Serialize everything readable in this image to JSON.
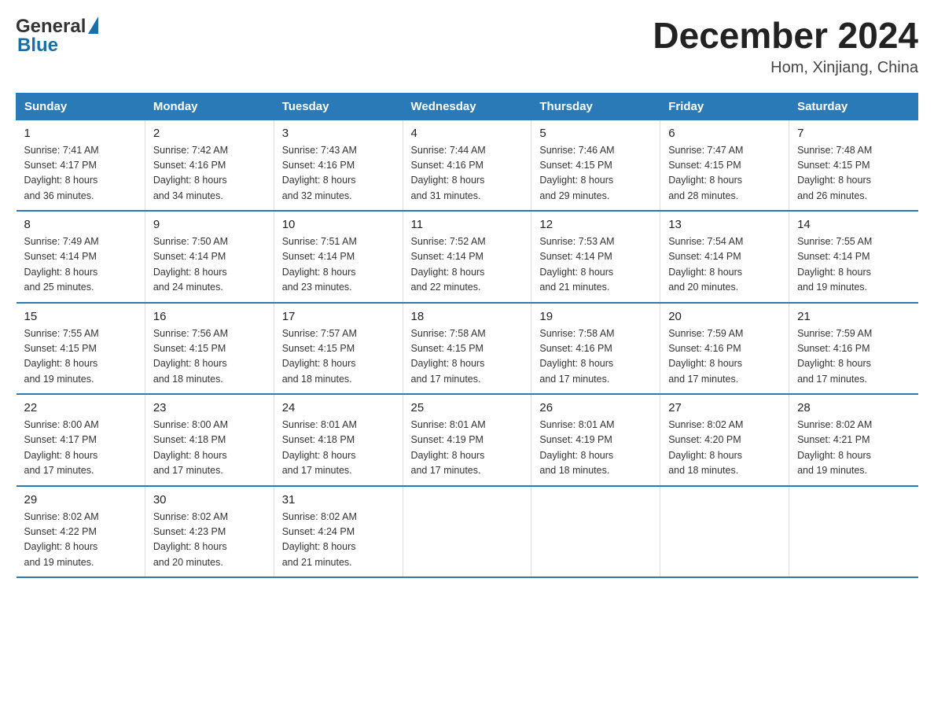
{
  "logo": {
    "text_general": "General",
    "text_blue": "Blue"
  },
  "header": {
    "month_year": "December 2024",
    "location": "Hom, Xinjiang, China"
  },
  "days_of_week": [
    "Sunday",
    "Monday",
    "Tuesday",
    "Wednesday",
    "Thursday",
    "Friday",
    "Saturday"
  ],
  "weeks": [
    [
      {
        "num": "1",
        "sunrise": "7:41 AM",
        "sunset": "4:17 PM",
        "daylight": "8 hours and 36 minutes."
      },
      {
        "num": "2",
        "sunrise": "7:42 AM",
        "sunset": "4:16 PM",
        "daylight": "8 hours and 34 minutes."
      },
      {
        "num": "3",
        "sunrise": "7:43 AM",
        "sunset": "4:16 PM",
        "daylight": "8 hours and 32 minutes."
      },
      {
        "num": "4",
        "sunrise": "7:44 AM",
        "sunset": "4:16 PM",
        "daylight": "8 hours and 31 minutes."
      },
      {
        "num": "5",
        "sunrise": "7:46 AM",
        "sunset": "4:15 PM",
        "daylight": "8 hours and 29 minutes."
      },
      {
        "num": "6",
        "sunrise": "7:47 AM",
        "sunset": "4:15 PM",
        "daylight": "8 hours and 28 minutes."
      },
      {
        "num": "7",
        "sunrise": "7:48 AM",
        "sunset": "4:15 PM",
        "daylight": "8 hours and 26 minutes."
      }
    ],
    [
      {
        "num": "8",
        "sunrise": "7:49 AM",
        "sunset": "4:14 PM",
        "daylight": "8 hours and 25 minutes."
      },
      {
        "num": "9",
        "sunrise": "7:50 AM",
        "sunset": "4:14 PM",
        "daylight": "8 hours and 24 minutes."
      },
      {
        "num": "10",
        "sunrise": "7:51 AM",
        "sunset": "4:14 PM",
        "daylight": "8 hours and 23 minutes."
      },
      {
        "num": "11",
        "sunrise": "7:52 AM",
        "sunset": "4:14 PM",
        "daylight": "8 hours and 22 minutes."
      },
      {
        "num": "12",
        "sunrise": "7:53 AM",
        "sunset": "4:14 PM",
        "daylight": "8 hours and 21 minutes."
      },
      {
        "num": "13",
        "sunrise": "7:54 AM",
        "sunset": "4:14 PM",
        "daylight": "8 hours and 20 minutes."
      },
      {
        "num": "14",
        "sunrise": "7:55 AM",
        "sunset": "4:14 PM",
        "daylight": "8 hours and 19 minutes."
      }
    ],
    [
      {
        "num": "15",
        "sunrise": "7:55 AM",
        "sunset": "4:15 PM",
        "daylight": "8 hours and 19 minutes."
      },
      {
        "num": "16",
        "sunrise": "7:56 AM",
        "sunset": "4:15 PM",
        "daylight": "8 hours and 18 minutes."
      },
      {
        "num": "17",
        "sunrise": "7:57 AM",
        "sunset": "4:15 PM",
        "daylight": "8 hours and 18 minutes."
      },
      {
        "num": "18",
        "sunrise": "7:58 AM",
        "sunset": "4:15 PM",
        "daylight": "8 hours and 17 minutes."
      },
      {
        "num": "19",
        "sunrise": "7:58 AM",
        "sunset": "4:16 PM",
        "daylight": "8 hours and 17 minutes."
      },
      {
        "num": "20",
        "sunrise": "7:59 AM",
        "sunset": "4:16 PM",
        "daylight": "8 hours and 17 minutes."
      },
      {
        "num": "21",
        "sunrise": "7:59 AM",
        "sunset": "4:16 PM",
        "daylight": "8 hours and 17 minutes."
      }
    ],
    [
      {
        "num": "22",
        "sunrise": "8:00 AM",
        "sunset": "4:17 PM",
        "daylight": "8 hours and 17 minutes."
      },
      {
        "num": "23",
        "sunrise": "8:00 AM",
        "sunset": "4:18 PM",
        "daylight": "8 hours and 17 minutes."
      },
      {
        "num": "24",
        "sunrise": "8:01 AM",
        "sunset": "4:18 PM",
        "daylight": "8 hours and 17 minutes."
      },
      {
        "num": "25",
        "sunrise": "8:01 AM",
        "sunset": "4:19 PM",
        "daylight": "8 hours and 17 minutes."
      },
      {
        "num": "26",
        "sunrise": "8:01 AM",
        "sunset": "4:19 PM",
        "daylight": "8 hours and 18 minutes."
      },
      {
        "num": "27",
        "sunrise": "8:02 AM",
        "sunset": "4:20 PM",
        "daylight": "8 hours and 18 minutes."
      },
      {
        "num": "28",
        "sunrise": "8:02 AM",
        "sunset": "4:21 PM",
        "daylight": "8 hours and 19 minutes."
      }
    ],
    [
      {
        "num": "29",
        "sunrise": "8:02 AM",
        "sunset": "4:22 PM",
        "daylight": "8 hours and 19 minutes."
      },
      {
        "num": "30",
        "sunrise": "8:02 AM",
        "sunset": "4:23 PM",
        "daylight": "8 hours and 20 minutes."
      },
      {
        "num": "31",
        "sunrise": "8:02 AM",
        "sunset": "4:24 PM",
        "daylight": "8 hours and 21 minutes."
      },
      null,
      null,
      null,
      null
    ]
  ],
  "labels": {
    "sunrise": "Sunrise:",
    "sunset": "Sunset:",
    "daylight": "Daylight:"
  }
}
